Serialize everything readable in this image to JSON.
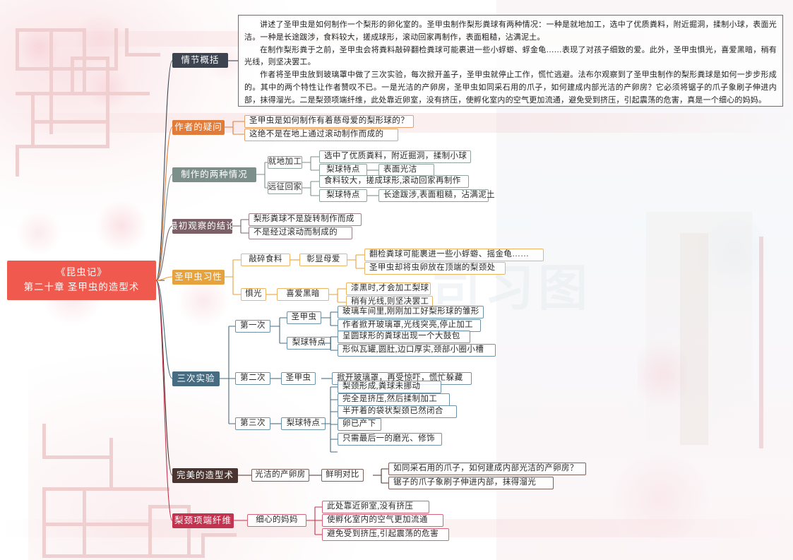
{
  "document": {
    "title": "《昆虫记》第二十章 圣甲虫的造型术 思维导图"
  },
  "central": {
    "line1": "《昆虫记》",
    "line2": "第二十章 圣甲虫的造型术",
    "color": "#f05a4e"
  },
  "colors": {
    "summary_branch": "#3d4450",
    "author_question": "#e07b39",
    "two_cases": "#7d8f8a",
    "first_conclusion": "#7b6068",
    "habits": "#e6a23c",
    "experiments": "#476b80",
    "perfect_craft": "#4a3430",
    "pear_fiber": "#c0344f"
  },
  "summary": {
    "label": "情节概括",
    "paragraphs": [
      "讲述了圣甲虫是如何制作一个梨形的卵化室的。圣甲虫制作梨形粪球有两种情况：一种是就地加工，选中了优质粪料，附近掘洞，揉制小球，表面光洁。一种是长途跋涉，食料较大，搓成球形，滚动回家再制作，表面粗糙，沾满泥土。",
      "在制作梨形粪于之前，圣甲虫会将粪料敲碎翻检粪球可能裹进一些小蜉蝣、蜉金龟……表现了对孩子细致的爱。此外，圣甲虫惧光，喜爱黑暗，稍有光线，则坚决罢工。",
      "作者将圣甲虫放到玻璃罩中做了三次实验，每次掀开盖子，圣甲虫就停止工作，慌忙逃避。法布尔观察到了圣甲虫制作的梨形粪球是如何一步步形成的。其中的两个特性让作者赞叹不已。一是光洁的产卵房，圣甲虫如同采石用的爪子，如何建成内部光洁的产卵房？它必须将锯子的爪子象刷子伸进内部，抹得溜光。二是梨颈项端纤维，此处靠近卵室，没有挤压，使孵化室内的空气更加流通，避免受到挤压，引起震荡的危害，真是一个细心的妈妈。"
    ]
  },
  "branches": [
    {
      "id": "author_question",
      "label": "作者的疑问",
      "children": [
        {
          "label": "圣甲虫是如何制作有着慈母爱的梨形球的？"
        },
        {
          "label": "这绝不是在地上通过滚动制作而成的"
        }
      ]
    },
    {
      "id": "two_cases",
      "label": "制作的两种情况",
      "children": [
        {
          "label": "就地加工",
          "children": [
            {
              "label": "选中了优质粪料，附近掘洞，揉制小球"
            },
            {
              "label": "梨球特点",
              "children": [
                {
                  "label": "表面光洁"
                }
              ]
            }
          ]
        },
        {
          "label": "远征回家",
          "children": [
            {
              "label": "食料较大，搓成球形,滚动回家再制作"
            },
            {
              "label": "梨球特点",
              "children": [
                {
                  "label": "长途跋涉,表面粗糙，沾满泥土"
                }
              ]
            }
          ]
        }
      ]
    },
    {
      "id": "first_conclusion",
      "label": "最初观察的结论",
      "children": [
        {
          "label": "梨形粪球不是旋转制作而成"
        },
        {
          "label": "不是经过滚动而制成的"
        }
      ]
    },
    {
      "id": "habits",
      "label": "圣甲虫习性",
      "children": [
        {
          "label": "敲碎食料",
          "children": [
            {
              "label": "彰显母爱",
              "children": [
                {
                  "label": "翻检粪球可能裹进一些小蜉蝣、摇金龟……"
                },
                {
                  "label": "圣甲虫却将虫卵放在顶端的梨颈处"
                }
              ]
            }
          ]
        },
        {
          "label": "惧光",
          "children": [
            {
              "label": "喜爱黑暗",
              "children": [
                {
                  "label": "漆黑时,才会加工梨球"
                },
                {
                  "label": "稍有光线,则坚决罢工"
                }
              ]
            }
          ]
        }
      ]
    },
    {
      "id": "experiments",
      "label": "三次实验",
      "children": [
        {
          "label": "第一次",
          "children": [
            {
              "label": "圣甲虫",
              "children": [
                {
                  "label": "玻璃车间里,刚刚加工好梨形球的雏形"
                },
                {
                  "label": "作者掀开玻璃罩,光线突亮,停止加工"
                }
              ]
            },
            {
              "label": "梨球特点",
              "children": [
                {
                  "label": "呈圆球形的粪球出现一个大鼓包"
                },
                {
                  "label": "形似瓦罐,圆肚,边口厚实,颈部小圈小槽"
                }
              ]
            }
          ]
        },
        {
          "label": "第二次",
          "children": [
            {
              "label": "圣甲虫",
              "children": [
                {
                  "label": "掀开玻璃罩，再受惊吓，慌忙躲藏"
                }
              ]
            }
          ]
        },
        {
          "label": "第三次",
          "children": [
            {
              "label": "梨球特点",
              "children": [
                {
                  "label": "梨颈形成,粪球未挪动"
                },
                {
                  "label": "完全是挤压,然后揉制加工"
                },
                {
                  "label": "半开着的袋状梨颈已然闭合"
                },
                {
                  "label": "卵已产下"
                },
                {
                  "label": "只需最后一的磨光、修饰"
                }
              ]
            }
          ]
        }
      ]
    },
    {
      "id": "perfect_craft",
      "label": "完美的造型术",
      "children": [
        {
          "label": "光洁的产卵房",
          "children": [
            {
              "label": "鲜明对比",
              "children": [
                {
                  "label": "如同采石用的爪子，如何建成内部光洁的产卵房？"
                },
                {
                  "label": "锯子的爪子象刷子伸进内部，抹得溜光"
                }
              ]
            }
          ]
        }
      ]
    },
    {
      "id": "pear_fiber",
      "label": "梨颈项端纤维",
      "children": [
        {
          "label": "细心的妈妈",
          "children": [
            {
              "label": "此处靠近卵室,没有挤压"
            },
            {
              "label": "使孵化室内的空气更加流通"
            },
            {
              "label": "避免受到挤压,引起震荡的危害"
            }
          ]
        }
      ]
    }
  ]
}
